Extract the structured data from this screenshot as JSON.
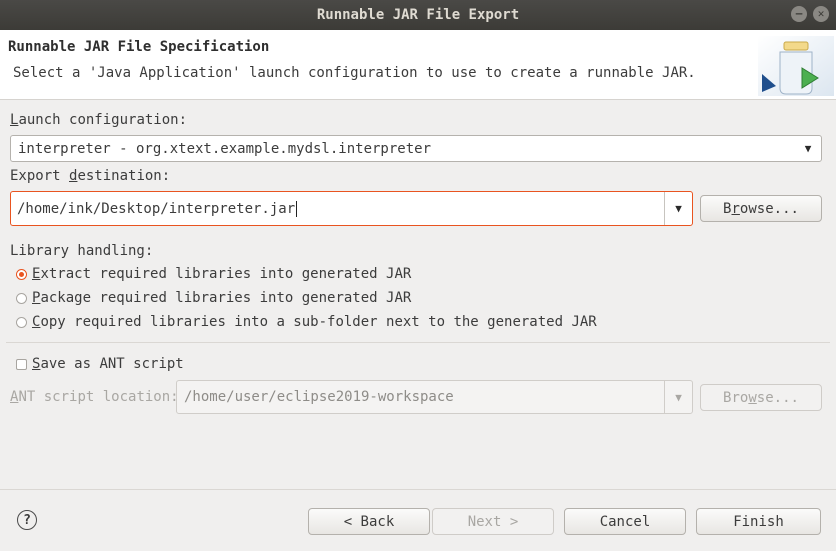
{
  "window": {
    "title": "Runnable JAR File Export"
  },
  "header": {
    "title": "Runnable JAR File Specification",
    "description": "Select a 'Java Application' launch configuration to use to create a runnable JAR."
  },
  "launch": {
    "label_pre": "",
    "label_mnemonic": "L",
    "label_post": "aunch configuration:",
    "value": "interpreter - org.xtext.example.mydsl.interpreter"
  },
  "export": {
    "label_pre": "Export ",
    "label_mnemonic": "d",
    "label_post": "estination:",
    "value": "/home/ink/Desktop/interpreter.jar",
    "browse_pre": "B",
    "browse_mnemonic": "r",
    "browse_post": "owse..."
  },
  "library": {
    "label": "Library handling:",
    "options": [
      {
        "mnemonic": "E",
        "rest": "xtract required libraries into generated JAR",
        "selected": true
      },
      {
        "mnemonic": "P",
        "rest": "ackage required libraries into generated JAR",
        "selected": false
      },
      {
        "mnemonic": "C",
        "rest": "opy required libraries into a sub-folder next to the generated JAR",
        "selected": false
      }
    ]
  },
  "ant": {
    "checkbox_mnemonic": "S",
    "checkbox_rest": "ave as ANT script",
    "checked": false,
    "location_mnemonic": "A",
    "location_rest": "NT script location:",
    "location_value": "/home/user/eclipse2019-workspace",
    "browse_pre": "Bro",
    "browse_mnemonic": "w",
    "browse_post": "se..."
  },
  "footer": {
    "back": "< Back",
    "next": "Next >",
    "cancel": "Cancel",
    "finish": "Finish"
  },
  "colors": {
    "accent": "#e95420",
    "titlebar": "#3c3b37"
  }
}
